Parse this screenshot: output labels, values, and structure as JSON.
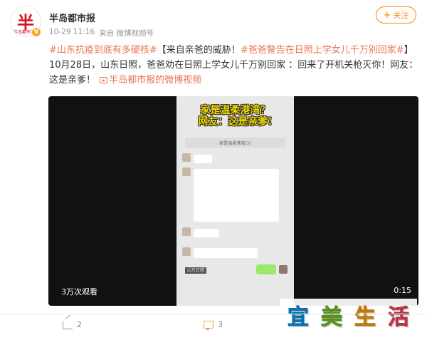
{
  "author": {
    "name": "半岛都市报",
    "avatar_text": "半",
    "avatar_sub": "半岛都市报",
    "verified": "V"
  },
  "meta": {
    "time": "10-29 11:16",
    "source": "来自 微博视频号"
  },
  "follow_label": "关注",
  "post": {
    "tag1": "#山东抗疫到底有多硬核#",
    "title": "【来自亲爸的威胁！",
    "tag2": "#爸爸警告在日照上学女儿千万别回家#",
    "title_end": "】",
    "body": "10月28日，山东日照，爸爸劝在日照上学女儿千万别回家 ：回来了开机关枪灭你！网友：这是亲爹！",
    "video_link": "半岛都市报的微博视频"
  },
  "video": {
    "caption_line1": "家是温柔港湾？",
    "caption_line2": "网友：这是亲爹!",
    "chat_title": "家是温柔港湾(3)",
    "views": "3万次观看",
    "duration": "0:15",
    "overlay_tag": "山东日照"
  },
  "brand_watermark": [
    "宜",
    "美",
    "生",
    "活"
  ],
  "actions": {
    "share_count": "2",
    "comment_count": "3"
  },
  "colors": {
    "accent": "#ff8200",
    "tag": "#eb7350"
  }
}
